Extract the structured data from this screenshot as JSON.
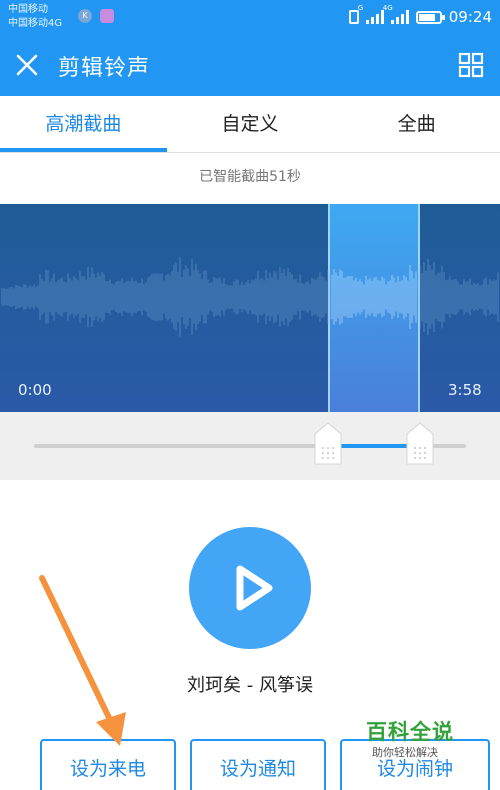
{
  "status_bar": {
    "carrier_line1": "中国移动",
    "carrier_line2": "中国移动4G",
    "app_icon1_letter": "K",
    "net1": "G",
    "net2": "4G",
    "battery_level": 0.8,
    "time": "09:24"
  },
  "app_bar": {
    "title": "剪辑铃声",
    "close_icon": "close-icon",
    "grid_icon": "grid-icon",
    "color": "#2196f3"
  },
  "tabs": [
    {
      "label": "高潮截曲",
      "active": true
    },
    {
      "label": "自定义",
      "active": false
    },
    {
      "label": "全曲",
      "active": false
    }
  ],
  "hint": "已智能截曲51秒",
  "waveform": {
    "start_time": "0:00",
    "end_time": "3:58"
  },
  "player": {
    "play_icon": "play-icon",
    "song_title": "刘珂矣 - 风筝误"
  },
  "actions": [
    "设为来电",
    "设为通知",
    "设为闹钟"
  ],
  "watermark": {
    "title": "百科全说",
    "subtitle": "助你轻松解决"
  },
  "colors": {
    "accent": "#2196f3",
    "annotation_arrow": "#f5923e",
    "watermark_green": "#33a23b"
  }
}
